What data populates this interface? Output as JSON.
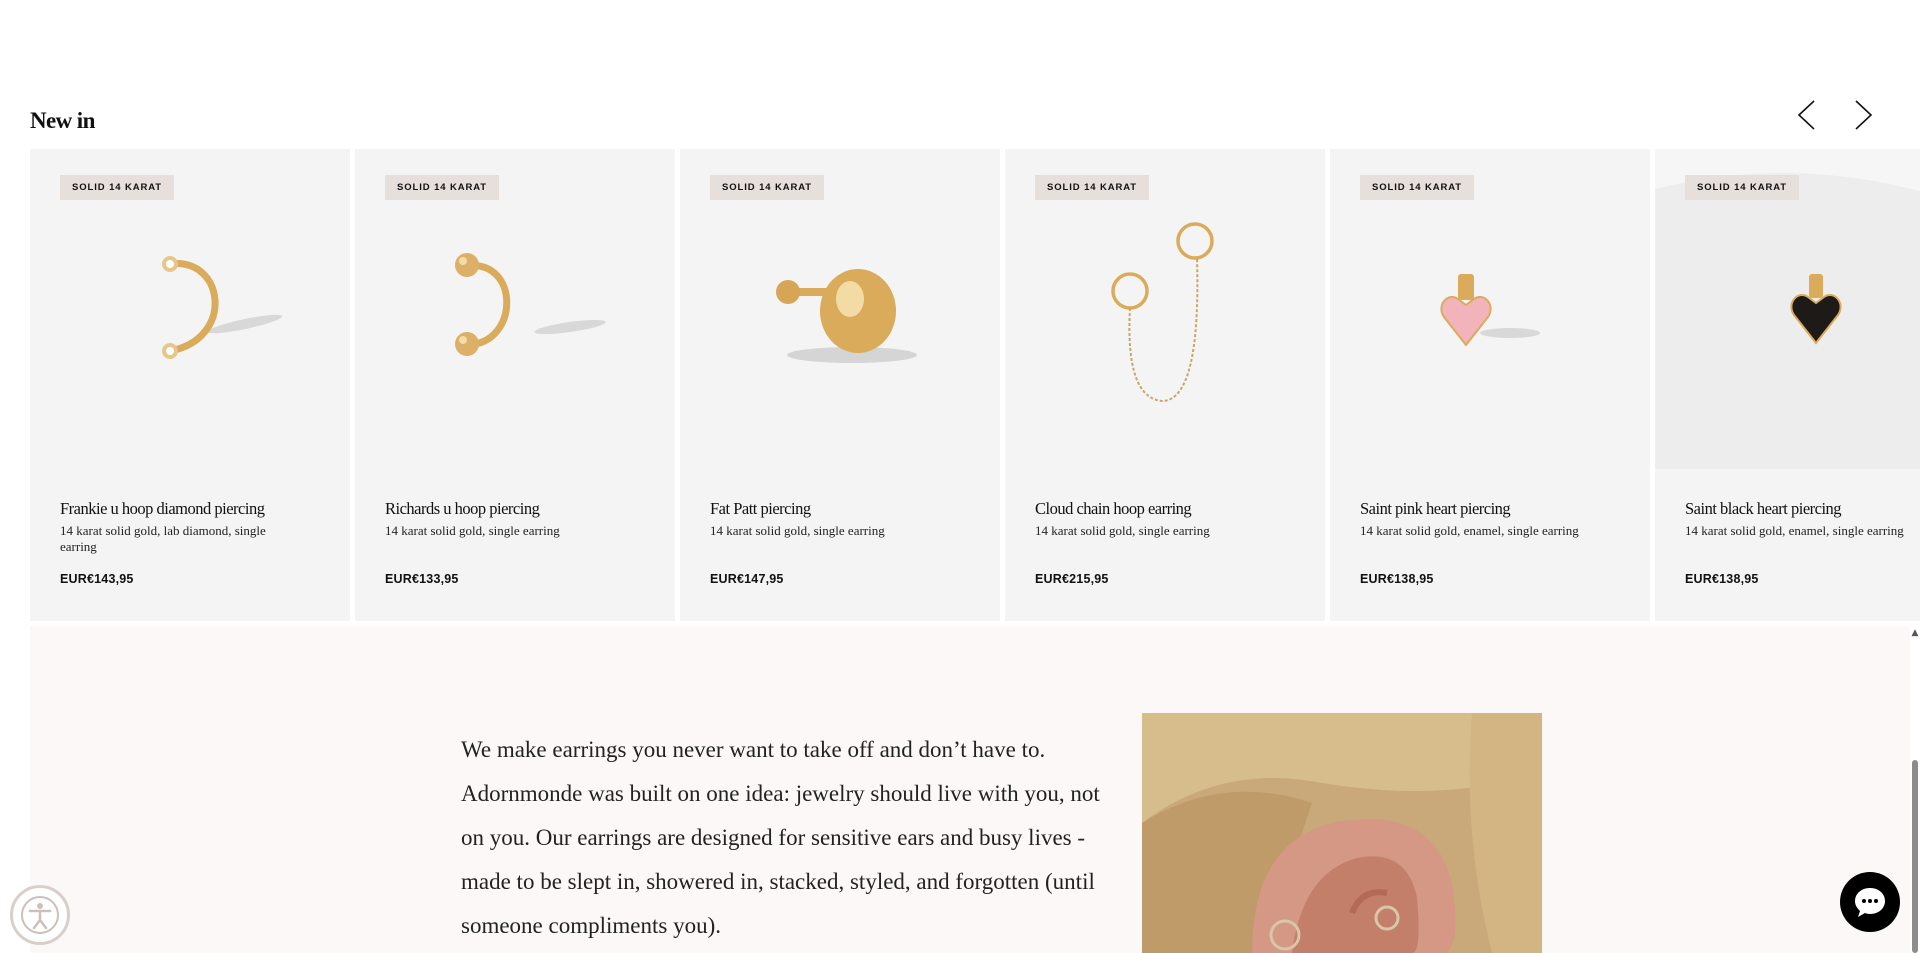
{
  "section": {
    "title": "New in"
  },
  "nav": {
    "prev_icon": "chevron-left-icon",
    "next_icon": "chevron-right-icon"
  },
  "products": [
    {
      "badge": "SOLID 14 KARAT",
      "name": "Frankie u hoop diamond piercing",
      "desc": "14 karat solid gold, lab diamond, single earring",
      "price": "EUR€143,95"
    },
    {
      "badge": "SOLID 14 KARAT",
      "name": "Richards u hoop piercing",
      "desc": "14 karat solid gold, single earring",
      "price": "EUR€133,95"
    },
    {
      "badge": "SOLID 14 KARAT",
      "name": "Fat Patt piercing",
      "desc": "14 karat solid gold, single earring",
      "price": "EUR€147,95"
    },
    {
      "badge": "SOLID 14 KARAT",
      "name": "Cloud chain hoop earring",
      "desc": "14 karat solid gold, single earring",
      "price": "EUR€215,95"
    },
    {
      "badge": "SOLID 14 KARAT",
      "name": "Saint pink heart piercing",
      "desc": "14 karat solid gold, enamel, single earring",
      "price": "EUR€138,95"
    },
    {
      "badge": "SOLID 14 KARAT",
      "name": "Saint black heart piercing",
      "desc": "14 karat solid gold, enamel, single earring",
      "price": "EUR€138,95"
    }
  ],
  "about": {
    "text": "We make earrings you never want to take off and don’t have to. Adornmonde was built on one idea: jewelry should live with you, not on you. Our earrings are designed for sensitive ears and busy lives - made to be slept in, showered in, stacked, styled, and forgotten (until someone compliments you)."
  },
  "colors": {
    "card_bg": "#f4f4f4",
    "badge_bg": "#e6dfdc",
    "gold": "#d9ab5b",
    "about_bg": "#fbf8f7"
  },
  "widgets": {
    "accessibility_icon": "accessibility-icon",
    "chat_icon": "chat-bubble-icon"
  }
}
